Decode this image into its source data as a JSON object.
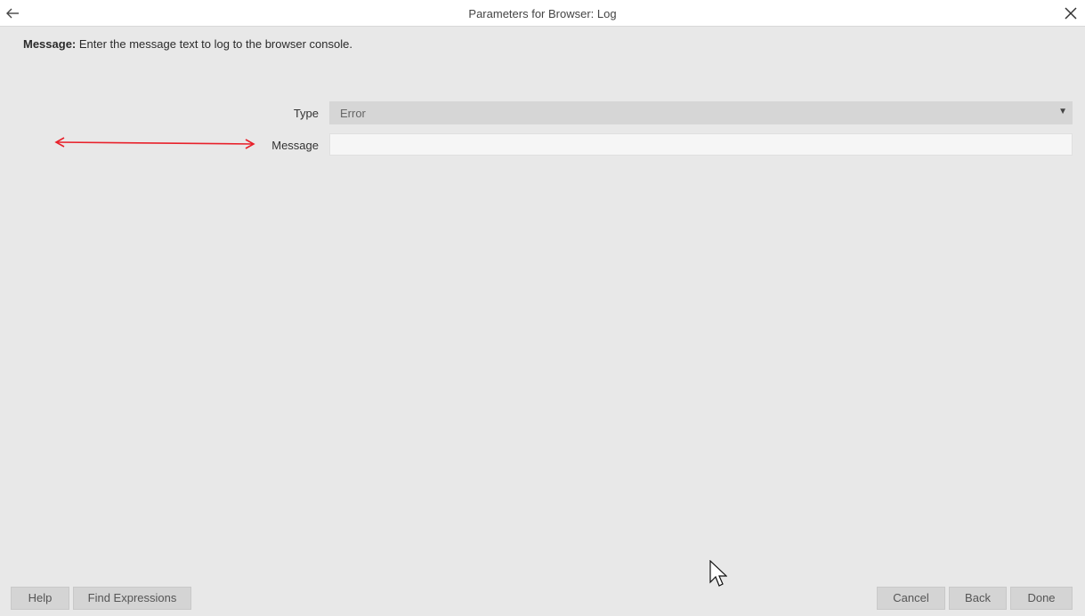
{
  "window": {
    "title": "Parameters for Browser: Log"
  },
  "description": {
    "bold": "Message:",
    "text": " Enter the message text to log to the browser console."
  },
  "fields": {
    "type": {
      "label": "Type",
      "value": "Error"
    },
    "message": {
      "label": "Message",
      "value": "",
      "placeholder": ""
    }
  },
  "footer": {
    "help_label": "Help",
    "find_expressions_label": "Find Expressions",
    "cancel_label": "Cancel",
    "back_label": "Back",
    "done_label": "Done"
  },
  "icons": {
    "back": "arrow-left-icon",
    "close": "close-icon",
    "dropdown": "caret-down-icon",
    "annotation": "double-arrow-annotation",
    "cursor": "mouse-pointer"
  },
  "colors": {
    "annotation": "#e8202a",
    "background": "#e8e8e8",
    "titlebar": "#ffffff"
  }
}
